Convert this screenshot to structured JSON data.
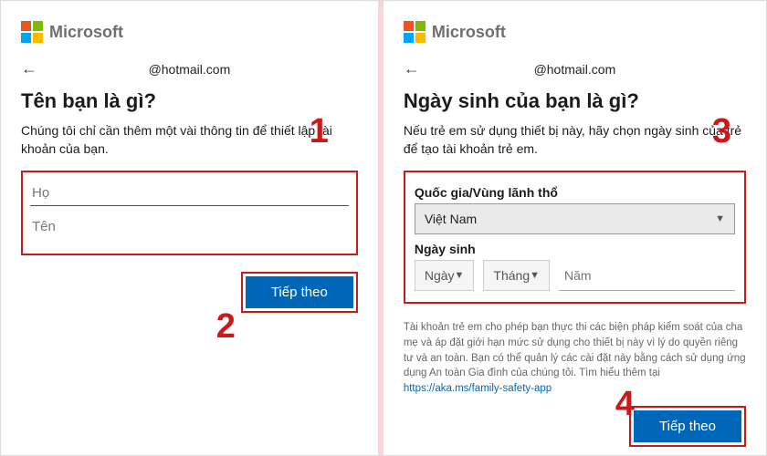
{
  "brand": "Microsoft",
  "left": {
    "email": "@hotmail.com",
    "heading": "Tên bạn là gì?",
    "subtitle": "Chúng tôi chỉ cần thêm một vài thông tin để thiết lập tài khoản của bạn.",
    "lastname_placeholder": "Họ",
    "firstname_placeholder": "Tên",
    "next": "Tiếp theo"
  },
  "right": {
    "email": "@hotmail.com",
    "heading": "Ngày sinh của bạn là gì?",
    "subtitle": "Nếu trẻ em sử dụng thiết bị này, hãy chọn ngày sinh của trẻ để tạo tài khoản trẻ em.",
    "country_label": "Quốc gia/Vùng lãnh thổ",
    "country_value": "Việt Nam",
    "dob_label": "Ngày sinh",
    "day": "Ngày",
    "month": "Tháng",
    "year": "Năm",
    "fineprint_a": "Tài khoản trẻ em cho phép bạn thực thi các biện pháp kiểm soát của cha mẹ và áp đặt giới hạn mức sử dụng cho thiết bị này vì lý do quyền riêng tư và an toàn. Bạn có thể quản lý các cài đặt này bằng cách sử dụng ứng dụng An toàn Gia đình của chúng tôi. Tìm hiểu thêm tại ",
    "fineprint_link": "https://aka.ms/family-safety-app",
    "next": "Tiếp theo"
  },
  "markers": {
    "m1": "1",
    "m2": "2",
    "m3": "3",
    "m4": "4"
  }
}
